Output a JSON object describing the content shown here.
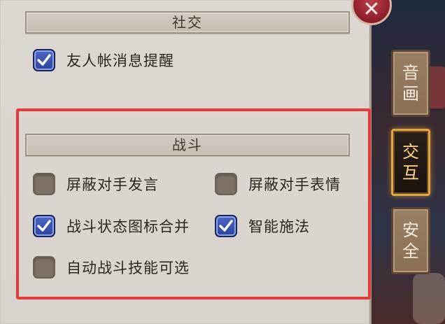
{
  "social": {
    "header": "社交",
    "options": [
      {
        "label": "友人帐消息提醒",
        "checked": true
      }
    ]
  },
  "battle": {
    "header": "战斗",
    "options": [
      {
        "label": "屏蔽对手发言",
        "checked": false
      },
      {
        "label": "屏蔽对手表情",
        "checked": false
      },
      {
        "label": "战斗状态图标合并",
        "checked": true
      },
      {
        "label": "智能施法",
        "checked": true
      },
      {
        "label": "自动战斗技能可选",
        "checked": false
      }
    ]
  },
  "tabs": [
    {
      "line1": "音",
      "line2": "画",
      "active": false
    },
    {
      "line1": "交",
      "line2": "互",
      "active": true
    },
    {
      "line1": "安",
      "line2": "全",
      "active": false
    }
  ],
  "close_icon": "close-x-icon",
  "colors": {
    "highlight": "#e43a3a",
    "checkbox_checked": "#3a55b8",
    "checkbox_unchecked": "#7d7168",
    "tab_active_border": "#e0a645"
  }
}
